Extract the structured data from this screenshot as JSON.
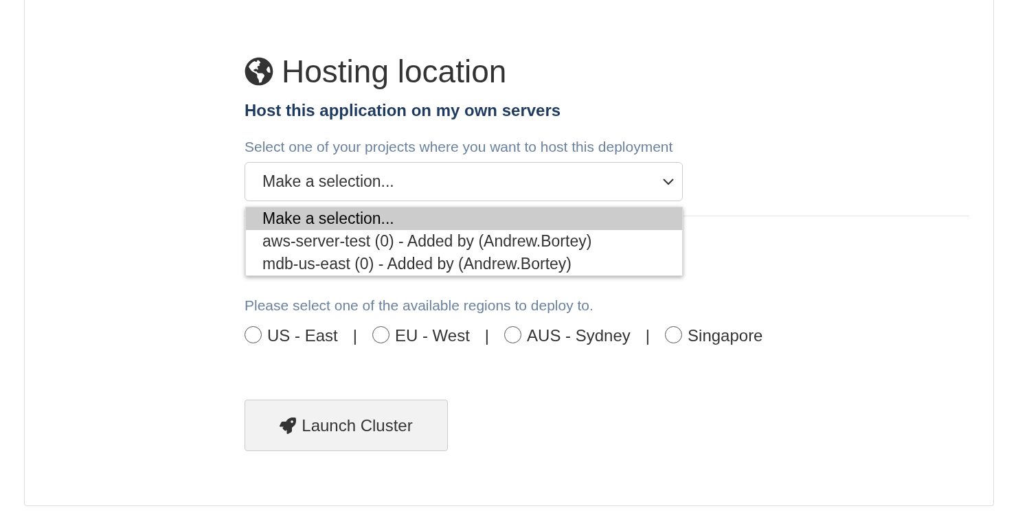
{
  "title": "Hosting location",
  "subheading": "Host this application on my own servers",
  "project_select": {
    "label": "Select one of your projects where you want to host this deployment",
    "value": "Make a selection...",
    "expanded": true,
    "options": [
      {
        "label": "Make a selection...",
        "selected": true
      },
      {
        "label": "aws-server-test (0) - Added by (Andrew.Bortey)",
        "selected": false
      },
      {
        "label": "mdb-us-east (0) - Added by (Andrew.Bortey)",
        "selected": false
      }
    ]
  },
  "region_label": "Please select one of the available regions to deploy to.",
  "regions": [
    {
      "label": "US - East",
      "selected": false
    },
    {
      "label": "EU - West",
      "selected": false
    },
    {
      "label": "AUS - Sydney",
      "selected": false
    },
    {
      "label": "Singapore",
      "selected": false
    }
  ],
  "separator": "|",
  "launch_button": "Launch Cluster"
}
